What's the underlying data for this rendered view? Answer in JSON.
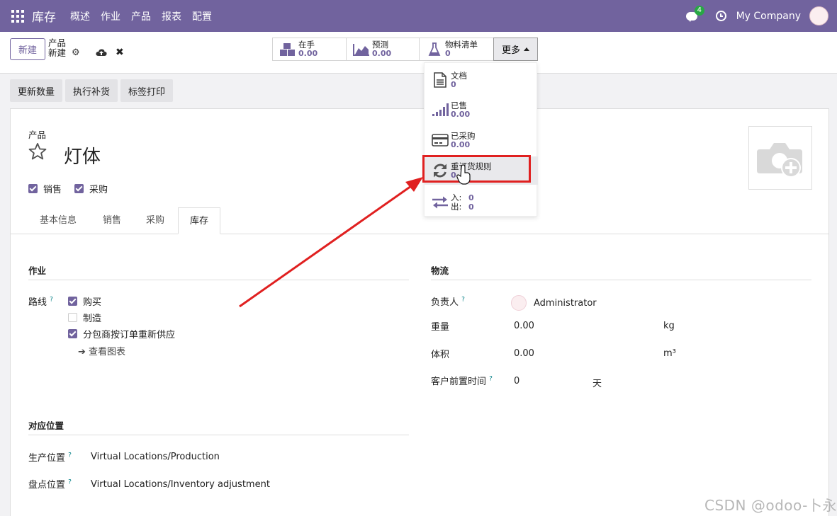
{
  "navbar": {
    "brand": "库存",
    "menu": [
      "概述",
      "作业",
      "产品",
      "报表",
      "配置"
    ],
    "chat_badge": "4",
    "company": "My Company"
  },
  "control": {
    "new_button": "新建",
    "breadcrumb_parent": "产品",
    "breadcrumb_current": "新建"
  },
  "smart_buttons": [
    {
      "label": "在手",
      "value": "0.00",
      "icon": "cubes-icon"
    },
    {
      "label": "预测",
      "value": "0.00",
      "icon": "area-chart-icon"
    },
    {
      "label": "物料清单",
      "value": "0",
      "icon": "flask-icon"
    }
  ],
  "more_button": "更多",
  "dropdown": [
    {
      "label": "文档",
      "value": "0",
      "icon": "document-icon"
    },
    {
      "label": "已售",
      "value": "0.00",
      "icon": "signal-icon"
    },
    {
      "label": "已采购",
      "value": "0.00",
      "icon": "credit-card-icon"
    },
    {
      "label": "重订货规则",
      "value": "0",
      "icon": "refresh-icon"
    },
    {
      "in_label": "入:",
      "in_value": "0",
      "out_label": "出:",
      "out_value": "0",
      "icon": "exchange-icon"
    }
  ],
  "actions": [
    "更新数量",
    "执行补货",
    "标签打印"
  ],
  "product": {
    "label": "产品",
    "name": "灯体",
    "checkboxes": [
      {
        "label": "销售",
        "checked": true
      },
      {
        "label": "采购",
        "checked": true
      }
    ]
  },
  "tabs": [
    "基本信息",
    "销售",
    "采购",
    "库存"
  ],
  "operations": {
    "title": "作业",
    "routes_label": "路线",
    "help_mark": "?",
    "routes": [
      {
        "label": "购买",
        "checked": true
      },
      {
        "label": "制造",
        "checked": false
      },
      {
        "label": "分包商按订单重新供应",
        "checked": true
      }
    ],
    "view_diagram": "查看图表"
  },
  "logistics": {
    "title": "物流",
    "responsible_label": "负责人",
    "responsible": "Administrator",
    "weight_label": "重量",
    "weight": "0.00",
    "weight_unit": "kg",
    "volume_label": "体积",
    "volume": "0.00",
    "volume_unit": "m³",
    "lead_label": "客户前置时间",
    "lead": "0",
    "lead_unit": "天"
  },
  "locations": {
    "title": "对应位置",
    "production_label": "生产位置",
    "production": "Virtual Locations/Production",
    "inventory_label": "盘点位置",
    "inventory": "Virtual Locations/Inventory adjustment"
  },
  "watermark": "CSDN @odoo-卜永",
  "colors": {
    "brand": "#71639e",
    "accent": "#017e84",
    "annotation": "#e02020"
  }
}
